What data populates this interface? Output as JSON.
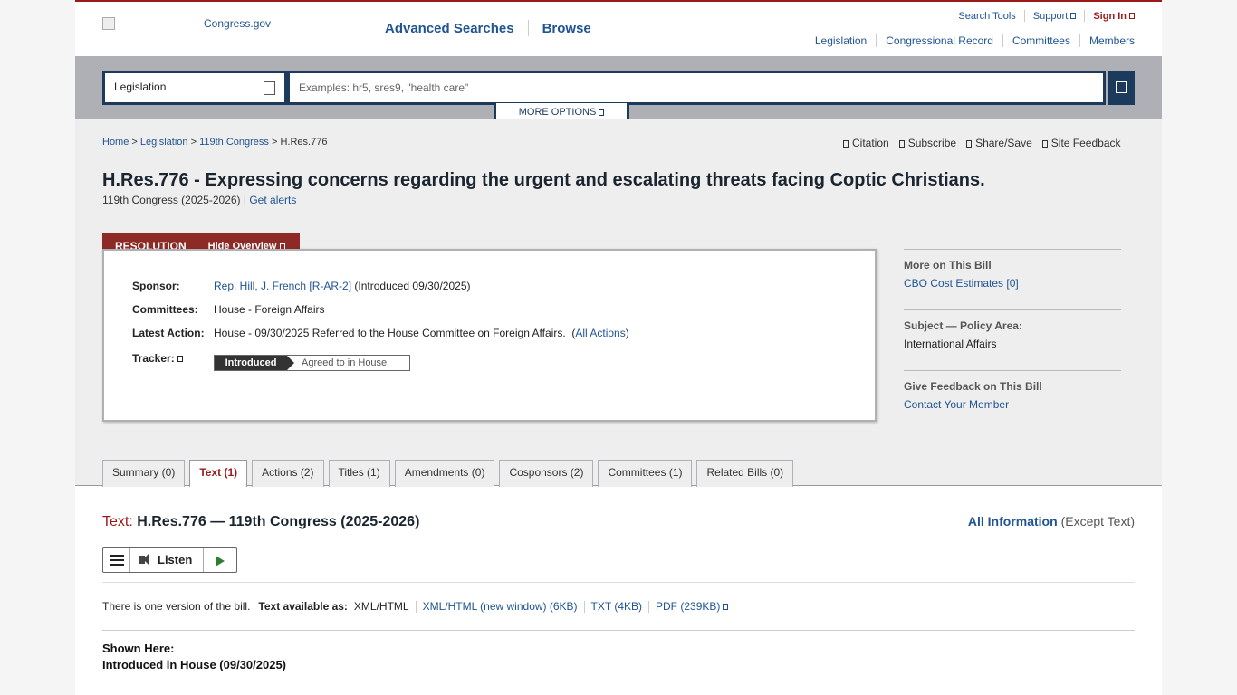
{
  "header": {
    "logo_text": "Congress.gov",
    "main_nav": [
      "Advanced Searches",
      "Browse"
    ],
    "util_nav": {
      "search_tools": "Search Tools",
      "support": "Support",
      "sign_in": "Sign In"
    },
    "sec_nav": [
      "Legislation",
      "Congressional Record",
      "Committees",
      "Members"
    ]
  },
  "search": {
    "scope": "Legislation",
    "placeholder": "Examples: hr5, sres9, \"health care\"",
    "more_options": "MORE OPTIONS"
  },
  "breadcrumb": {
    "home": "Home",
    "legislation": "Legislation",
    "congress": "119th Congress",
    "current": "H.Res.776",
    "sep": ">"
  },
  "tools": [
    "Citation",
    "Subscribe",
    "Share/Save",
    "Site Feedback"
  ],
  "bill": {
    "title": "H.Res.776 - Expressing concerns regarding the urgent and escalating threats facing Coptic Christians.",
    "congress": "119th Congress (2025-2026)",
    "get_alerts": "Get alerts",
    "type_tab": "RESOLUTION",
    "hide_overview": "Hide Overview"
  },
  "overview": {
    "sponsor_label": "Sponsor:",
    "sponsor_link": "Rep. Hill, J. French [R-AR-2]",
    "sponsor_intro": "(Introduced 09/30/2025)",
    "committees_label": "Committees:",
    "committees_value": "House - Foreign Affairs",
    "latest_label": "Latest Action:",
    "latest_value": "House - 09/30/2025 Referred to the House Committee on Foreign Affairs.",
    "all_actions": "All Actions",
    "tracker_label": "Tracker:",
    "tracker_done": "Introduced",
    "tracker_next": "Agreed to in House"
  },
  "sidebar": {
    "more_heading": "More on This Bill",
    "cbo_link": "CBO Cost Estimates [0]",
    "subject_heading": "Subject — Policy Area:",
    "subject_value": "International Affairs",
    "feedback_heading": "Give Feedback on This Bill",
    "contact_link": "Contact Your Member"
  },
  "tabs": [
    "Summary (0)",
    "Text (1)",
    "Actions (2)",
    "Titles (1)",
    "Amendments (0)",
    "Cosponsors (2)",
    "Committees (1)",
    "Related Bills (0)"
  ],
  "text_section": {
    "label": "Text:",
    "heading": "H.Res.776 — 119th Congress (2025-2026)",
    "all_info_link": "All Information",
    "all_info_note": "(Except Text)",
    "listen": "Listen",
    "versions_note": "There is one version of the bill.",
    "available_label": "Text available as:",
    "format_current": "XML/HTML",
    "format_links": [
      "XML/HTML (new window) (6KB)",
      "TXT (4KB)",
      "PDF (239KB)"
    ],
    "shown_here": "Shown Here:",
    "shown_version": "Introduced in House (09/30/2025)"
  }
}
